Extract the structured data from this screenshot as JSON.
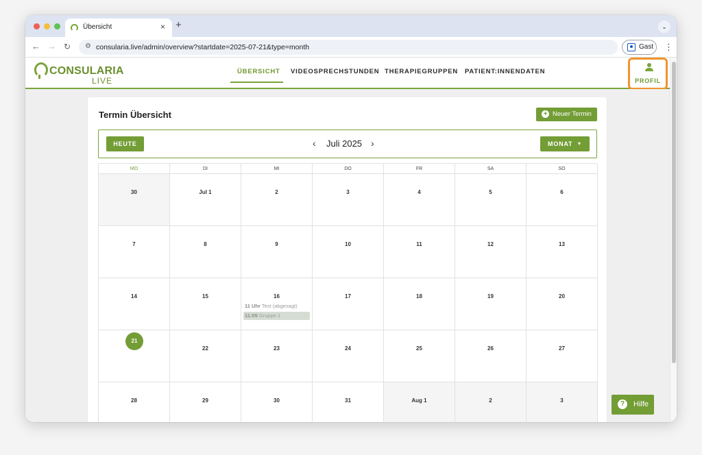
{
  "browser": {
    "tab_title": "Übersicht",
    "tab_close": "×",
    "new_tab": "+",
    "dropdown": "⌄",
    "url": "consularia.live/admin/overview?startdate=2025-07-21&type=month",
    "guest_label": "Gast",
    "back": "←",
    "forward": "→",
    "reload": "↻",
    "menu": "⋮",
    "site_icon": "⚙"
  },
  "header": {
    "logo_name": "CONSULARIA",
    "logo_sub": "LIVE",
    "nav": [
      {
        "label": "ÜBERSICHT",
        "active": true
      },
      {
        "label": "VIDEOSPRECHSTUNDEN",
        "active": false
      },
      {
        "label": "THERAPIEGRUPPEN",
        "active": false
      },
      {
        "label": "PATIENT:INNENDATEN",
        "active": false
      }
    ],
    "profile_label": "PROFIL"
  },
  "card": {
    "title": "Termin Übersicht",
    "new_button": "Neuer Termin"
  },
  "calendar": {
    "today_button": "HEUTE",
    "prev": "‹",
    "next": "›",
    "month_title": "Juli 2025",
    "view_button": "MONAT",
    "view_caret": "▾",
    "weekdays": [
      "MO",
      "DI",
      "MI",
      "DO",
      "FR",
      "SA",
      "SO"
    ],
    "today_weekday_index": 0,
    "weeks": [
      [
        {
          "label": "30",
          "other": true
        },
        {
          "label": "Jul 1"
        },
        {
          "label": "2"
        },
        {
          "label": "3"
        },
        {
          "label": "4"
        },
        {
          "label": "5"
        },
        {
          "label": "6"
        }
      ],
      [
        {
          "label": "7"
        },
        {
          "label": "8"
        },
        {
          "label": "9"
        },
        {
          "label": "10"
        },
        {
          "label": "11"
        },
        {
          "label": "12"
        },
        {
          "label": "13"
        }
      ],
      [
        {
          "label": "14"
        },
        {
          "label": "15"
        },
        {
          "label": "16",
          "events": [
            {
              "time": "11 Uhr",
              "title": "Test (abgesagt)",
              "style": "plain"
            },
            {
              "time": "11:05",
              "title": "Gruppe 1",
              "style": "group"
            }
          ]
        },
        {
          "label": "17"
        },
        {
          "label": "18"
        },
        {
          "label": "19"
        },
        {
          "label": "20"
        }
      ],
      [
        {
          "label": "21",
          "today": true
        },
        {
          "label": "22"
        },
        {
          "label": "23"
        },
        {
          "label": "24"
        },
        {
          "label": "25"
        },
        {
          "label": "26"
        },
        {
          "label": "27"
        }
      ],
      [
        {
          "label": "28"
        },
        {
          "label": "29"
        },
        {
          "label": "30"
        },
        {
          "label": "31"
        },
        {
          "label": "Aug 1",
          "other": true
        },
        {
          "label": "2",
          "other": true
        },
        {
          "label": "3",
          "other": true
        }
      ]
    ]
  },
  "help": {
    "label": "Hilfe",
    "icon": "?"
  },
  "colors": {
    "brand_green": "#739d35",
    "highlight_orange": "#f0932c"
  }
}
